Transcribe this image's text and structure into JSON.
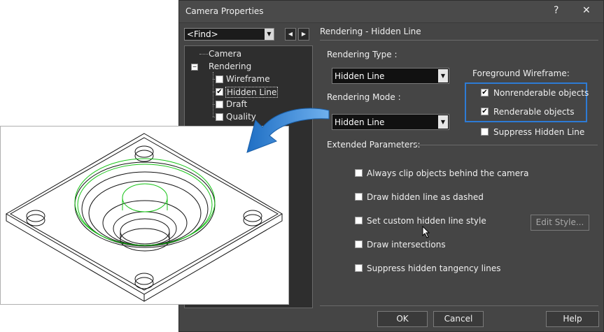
{
  "dialog": {
    "title": "Camera Properties",
    "help_glyph": "?",
    "close_glyph": "✕"
  },
  "find": {
    "value": "<Find>"
  },
  "tree": {
    "items": [
      {
        "label": "Camera"
      },
      {
        "label": "Rendering",
        "expander": "−"
      },
      {
        "label": "Wireframe",
        "checked": false
      },
      {
        "label": "Hidden Line",
        "checked": true
      },
      {
        "label": "Draft",
        "checked": false
      },
      {
        "label": "Quality",
        "checked": false
      }
    ]
  },
  "panel": {
    "heading": "Rendering - Hidden Line",
    "rendering_type": {
      "label": "Rendering Type :",
      "value": "Hidden Line"
    },
    "rendering_mode": {
      "label": "Rendering Mode :",
      "value": "Hidden Line"
    },
    "foreground": {
      "label": "Foreground Wireframe:",
      "options": [
        {
          "label": "Nonrenderable objects",
          "checked": true
        },
        {
          "label": "Renderable objects",
          "checked": true
        }
      ],
      "suppress": {
        "label": "Suppress Hidden Line",
        "checked": false
      }
    },
    "extended": {
      "label": "Extended Parameters:",
      "options": [
        {
          "label": "Always clip objects behind the camera",
          "checked": false
        },
        {
          "label": "Draw hidden line as dashed",
          "checked": false
        },
        {
          "label": "Set custom hidden line style",
          "checked": false
        },
        {
          "label": "Draw intersections",
          "checked": false
        },
        {
          "label": "Suppress hidden tangency lines",
          "checked": false
        }
      ],
      "edit_style": "Edit Style..."
    }
  },
  "buttons": {
    "ok": "OK",
    "cancel": "Cancel",
    "help": "Help"
  },
  "colors": {
    "dialog_bg": "#454545",
    "highlight": "#2d7bd5",
    "arrow": "#1f6fc4",
    "model_green": "#18c418"
  }
}
